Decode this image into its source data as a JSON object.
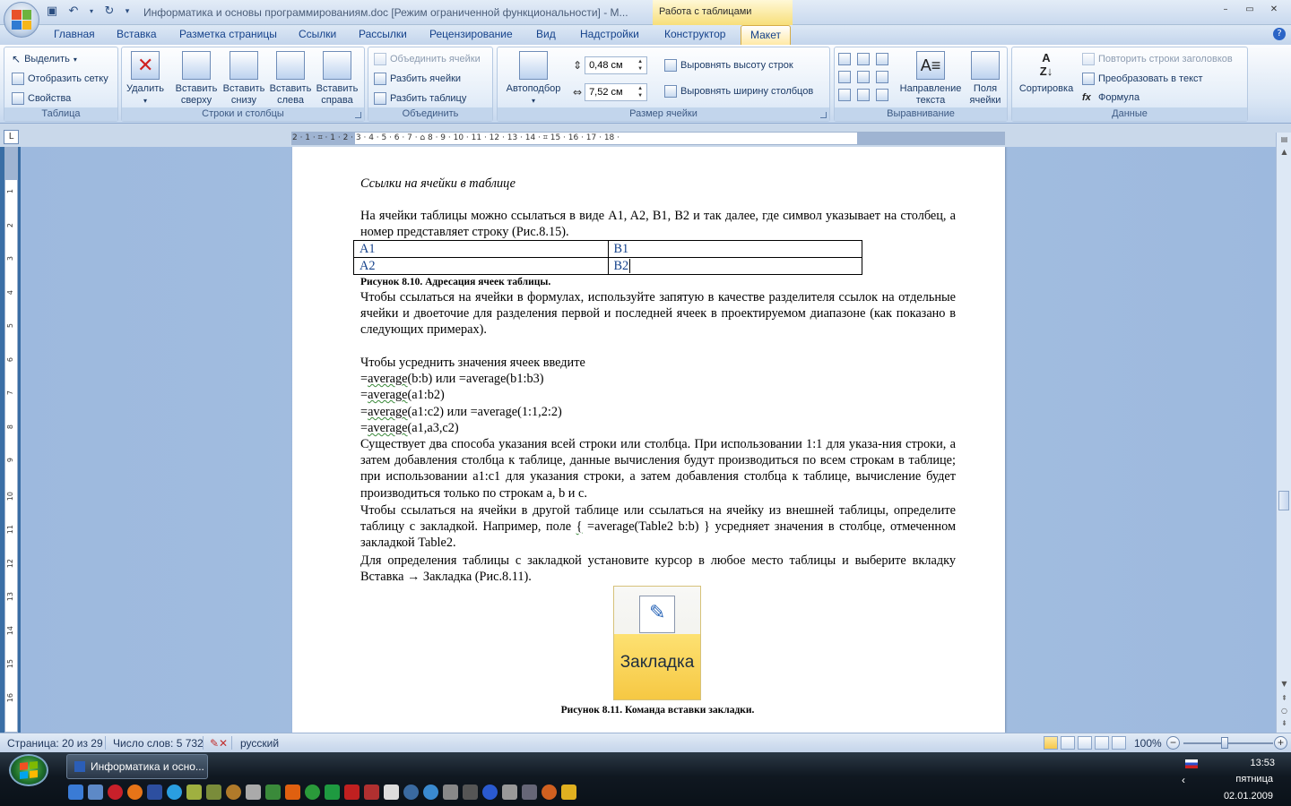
{
  "title_bar": {
    "document_title": "Информатика и основы программированиям.doc [Режим ограниченной функциональности] - M...",
    "context_tab_title": "Работа с таблицами",
    "minimize": "–",
    "restore": "▭",
    "close": "✕"
  },
  "tabs": [
    {
      "label": "Главная"
    },
    {
      "label": "Вставка"
    },
    {
      "label": "Разметка страницы"
    },
    {
      "label": "Ссылки"
    },
    {
      "label": "Рассылки"
    },
    {
      "label": "Рецензирование"
    },
    {
      "label": "Вид"
    },
    {
      "label": "Надстройки"
    },
    {
      "label": "Конструктор"
    },
    {
      "label": "Макет"
    }
  ],
  "ribbon": {
    "table_group": {
      "label": "Таблица",
      "select": "Выделить",
      "show_grid": "Отобразить сетку",
      "properties": "Свойства"
    },
    "rows_cols_group": {
      "label": "Строки и столбцы",
      "delete": "Удалить",
      "insert_above": "Вставить сверху",
      "insert_below": "Вставить снизу",
      "insert_left": "Вставить слева",
      "insert_right": "Вставить справа"
    },
    "merge_group": {
      "label": "Объединить",
      "merge_cells": "Объединить ячейки",
      "split_cells": "Разбить ячейки",
      "split_table": "Разбить таблицу"
    },
    "cell_size_group": {
      "label": "Размер ячейки",
      "autofit": "Автоподбор",
      "height": "0,48 см",
      "width": "7,52 см",
      "distribute_rows": "Выровнять высоту строк",
      "distribute_cols": "Выровнять ширину столбцов"
    },
    "alignment_group": {
      "label": "Выравнивание",
      "text_direction": "Направление текста",
      "cell_margins": "Поля ячейки"
    },
    "data_group": {
      "label": "Данные",
      "sort": "Сортировка",
      "repeat_header": "Повторить строки заголовков",
      "convert_text": "Преобразовать в текст",
      "formula": "Формула"
    }
  },
  "ruler_numbers": "2 · 1 · ⌗ · 1 · 2 · 3 · 4 · 5 · 6 · 7 · ⌂ 8 · 9 · 10 · 11 · 12 · 13 · 14 · ⌗ 15 · 16 · 17 · 18 ·",
  "vruler_numbers": [
    "1",
    "2",
    "3",
    "4",
    "5",
    "6",
    "7",
    "8",
    "9",
    "10",
    "11",
    "12",
    "13",
    "14",
    "15",
    "16"
  ],
  "document": {
    "heading": "Ссылки на ячейки в таблице",
    "p1": "На ячейки таблицы можно ссылаться в виде A1, A2, B1, B2 и так далее, где символ указывает на столбец, а номер представляет строку (Рис.8.15).",
    "table": [
      [
        "A1",
        "B1"
      ],
      [
        "A2",
        "B2"
      ]
    ],
    "caption1": "Рисунок 8.10. Адресация ячеек таблицы.",
    "p2": "Чтобы ссылаться на ячейки в формулах, используйте запятую в качестве разделителя ссылок на отдельные ячейки и двоеточие для разделения первой и последней ячеек в проектируемом диапазоне (как показано в следующих примерах).",
    "p3": "Чтобы усреднить значения ячеек   введите",
    "f1_eq": "=",
    "f1_fn": "average",
    "f1_rest": "(b:b) или =average(b1:b3)",
    "f2_eq": "=",
    "f2_fn": "average",
    "f2_rest": "(a1:b2)",
    "f3_eq": "=",
    "f3_fn": "average",
    "f3_rest": "(a1:c2) или =average(1:1,2:2)",
    "f4_eq": "=",
    "f4_fn": "average",
    "f4_rest": "(a1,a3,c2)",
    "p4": "Существует два способа указания всей строки или столбца. При использовании 1:1 для указа-ния строки, а затем добавления столбца к таблице, данные вычисления будут производиться по всем строкам в таблице; при использовании a1:c1 для указания строки, а затем добавления столбца к таблице, вычисление будет производиться только по строкам a, b и c.",
    "p5_a": "Чтобы ссылаться на ячейки в другой таблице или ссылаться на ячейку из внешней таблицы, определите таблицу с закладкой. Например, поле ",
    "p5_brace": "{",
    "p5_b": " =average(Table2 b:b) } усредняет значения в столбце, отмеченном закладкой Table2.",
    "p6": "Для определения таблицы с закладкой установите курсор в любое место таблицы и выберите вкладку Вставка → Закладка (Рис.8.11).",
    "image_label": "Закладка",
    "caption2": "Рисунок 8.11. Команда вставки закладки."
  },
  "status_bar": {
    "page": "Страница: 20 из 29",
    "words": "Число слов: 5 732",
    "language": "русский",
    "zoom": "100%"
  },
  "taskbar": {
    "task_word": "Информатика и осно...",
    "time": "13:53",
    "day": "пятница",
    "date": "02.01.2009"
  },
  "colors": {
    "ribbon_active_tab": "#ffeaa6",
    "context_tab": "#f7df7a",
    "doc_background": "#a6c0e1",
    "taskbar": "#101821"
  }
}
